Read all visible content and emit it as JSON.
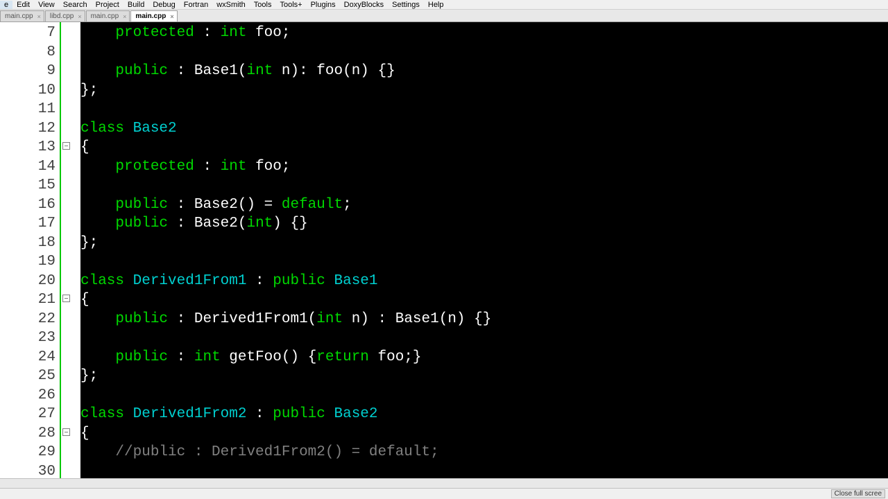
{
  "menubar": [
    "e",
    "Edit",
    "View",
    "Search",
    "Project",
    "Build",
    "Debug",
    "Fortran",
    "wxSmith",
    "Tools",
    "Tools+",
    "Plugins",
    "DoxyBlocks",
    "Settings",
    "Help"
  ],
  "tabs": [
    {
      "label": "main.cpp",
      "active": false
    },
    {
      "label": "libd.cpp",
      "active": false
    },
    {
      "label": "main.cpp",
      "active": false
    },
    {
      "label": "main.cpp",
      "active": true
    }
  ],
  "first_line_number": 7,
  "fold_lines": [
    13,
    21,
    28
  ],
  "code_lines": [
    [
      [
        "    ",
        "w"
      ],
      [
        "protected",
        "g"
      ],
      [
        " : ",
        "w"
      ],
      [
        "int",
        "g"
      ],
      [
        " foo;",
        "w"
      ]
    ],
    [
      [
        "",
        "w"
      ]
    ],
    [
      [
        "    ",
        "w"
      ],
      [
        "public",
        "g"
      ],
      [
        " : Base1(",
        "w"
      ],
      [
        "int",
        "g"
      ],
      [
        " n): foo(n) {}",
        "w"
      ]
    ],
    [
      [
        "};",
        "w"
      ]
    ],
    [
      [
        "",
        "w"
      ]
    ],
    [
      [
        "class",
        "g"
      ],
      [
        " ",
        "w"
      ],
      [
        "Base2",
        "t"
      ]
    ],
    [
      [
        "{",
        "w"
      ]
    ],
    [
      [
        "    ",
        "w"
      ],
      [
        "protected",
        "g"
      ],
      [
        " : ",
        "w"
      ],
      [
        "int",
        "g"
      ],
      [
        " foo;",
        "w"
      ]
    ],
    [
      [
        "",
        "w"
      ]
    ],
    [
      [
        "    ",
        "w"
      ],
      [
        "public",
        "g"
      ],
      [
        " : Base2() = ",
        "w"
      ],
      [
        "default",
        "g"
      ],
      [
        ";",
        "w"
      ]
    ],
    [
      [
        "    ",
        "w"
      ],
      [
        "public",
        "g"
      ],
      [
        " : Base2(",
        "w"
      ],
      [
        "int",
        "g"
      ],
      [
        ") {}",
        "w"
      ]
    ],
    [
      [
        "};",
        "w"
      ]
    ],
    [
      [
        "",
        "w"
      ]
    ],
    [
      [
        "class",
        "g"
      ],
      [
        " ",
        "w"
      ],
      [
        "Derived1From1",
        "t"
      ],
      [
        " : ",
        "w"
      ],
      [
        "public",
        "g"
      ],
      [
        " ",
        "w"
      ],
      [
        "Base1",
        "t"
      ]
    ],
    [
      [
        "{",
        "w"
      ]
    ],
    [
      [
        "    ",
        "w"
      ],
      [
        "public",
        "g"
      ],
      [
        " : Derived1From1(",
        "w"
      ],
      [
        "int",
        "g"
      ],
      [
        " n) : Base1(n) {}",
        "w"
      ]
    ],
    [
      [
        "",
        "w"
      ]
    ],
    [
      [
        "    ",
        "w"
      ],
      [
        "public",
        "g"
      ],
      [
        " : ",
        "w"
      ],
      [
        "int",
        "g"
      ],
      [
        " getFoo() {",
        "w"
      ],
      [
        "return",
        "g"
      ],
      [
        " foo;}",
        "w"
      ]
    ],
    [
      [
        "};",
        "w"
      ]
    ],
    [
      [
        "",
        "w"
      ]
    ],
    [
      [
        "class",
        "g"
      ],
      [
        " ",
        "w"
      ],
      [
        "Derived1From2",
        "t"
      ],
      [
        " : ",
        "w"
      ],
      [
        "public",
        "g"
      ],
      [
        " ",
        "w"
      ],
      [
        "Base2",
        "t"
      ]
    ],
    [
      [
        "{",
        "w"
      ]
    ],
    [
      [
        "    ",
        "w"
      ],
      [
        "//public : Derived1From2() = default;",
        "gr"
      ]
    ],
    [
      [
        "",
        "w"
      ]
    ]
  ],
  "status": {
    "close_fullscreen": "Close full scree"
  }
}
